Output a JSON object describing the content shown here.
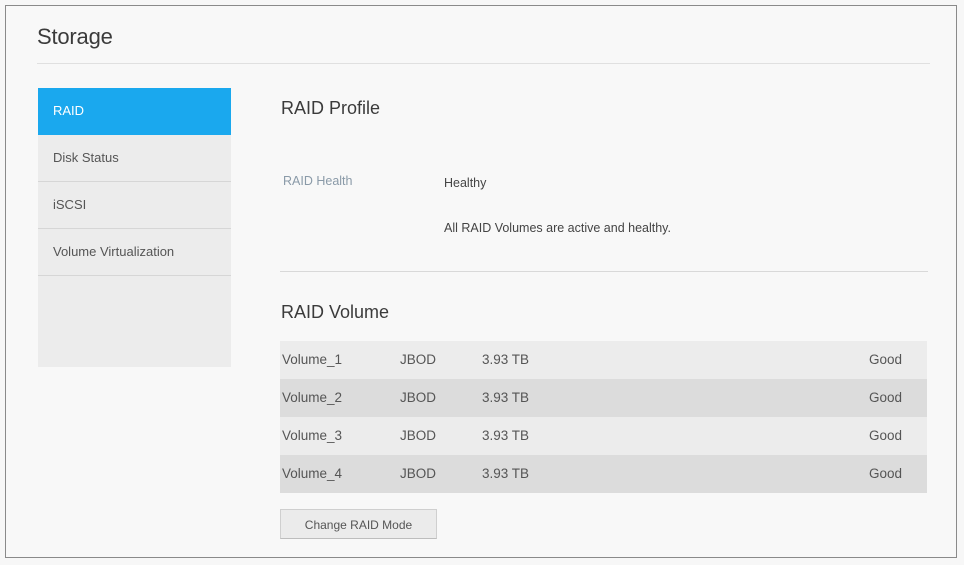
{
  "page": {
    "title": "Storage"
  },
  "sidebar": {
    "items": [
      {
        "label": "RAID",
        "active": true
      },
      {
        "label": "Disk Status",
        "active": false
      },
      {
        "label": "iSCSI",
        "active": false
      },
      {
        "label": "Volume Virtualization",
        "active": false
      }
    ]
  },
  "raid_profile": {
    "title": "RAID Profile",
    "health_label": "RAID Health",
    "health_value": "Healthy",
    "health_message": "All RAID Volumes are active and healthy."
  },
  "raid_volume": {
    "title": "RAID Volume",
    "rows": [
      {
        "name": "Volume_1",
        "type": "JBOD",
        "size": "3.93 TB",
        "status": "Good"
      },
      {
        "name": "Volume_2",
        "type": "JBOD",
        "size": "3.93 TB",
        "status": "Good"
      },
      {
        "name": "Volume_3",
        "type": "JBOD",
        "size": "3.93 TB",
        "status": "Good"
      },
      {
        "name": "Volume_4",
        "type": "JBOD",
        "size": "3.93 TB",
        "status": "Good"
      }
    ],
    "change_button": "Change RAID Mode"
  },
  "colors": {
    "accent": "#1aa8ee",
    "sidebar_bg": "#ececec",
    "row_odd": "#ececec",
    "row_even": "#dcdcdc"
  }
}
